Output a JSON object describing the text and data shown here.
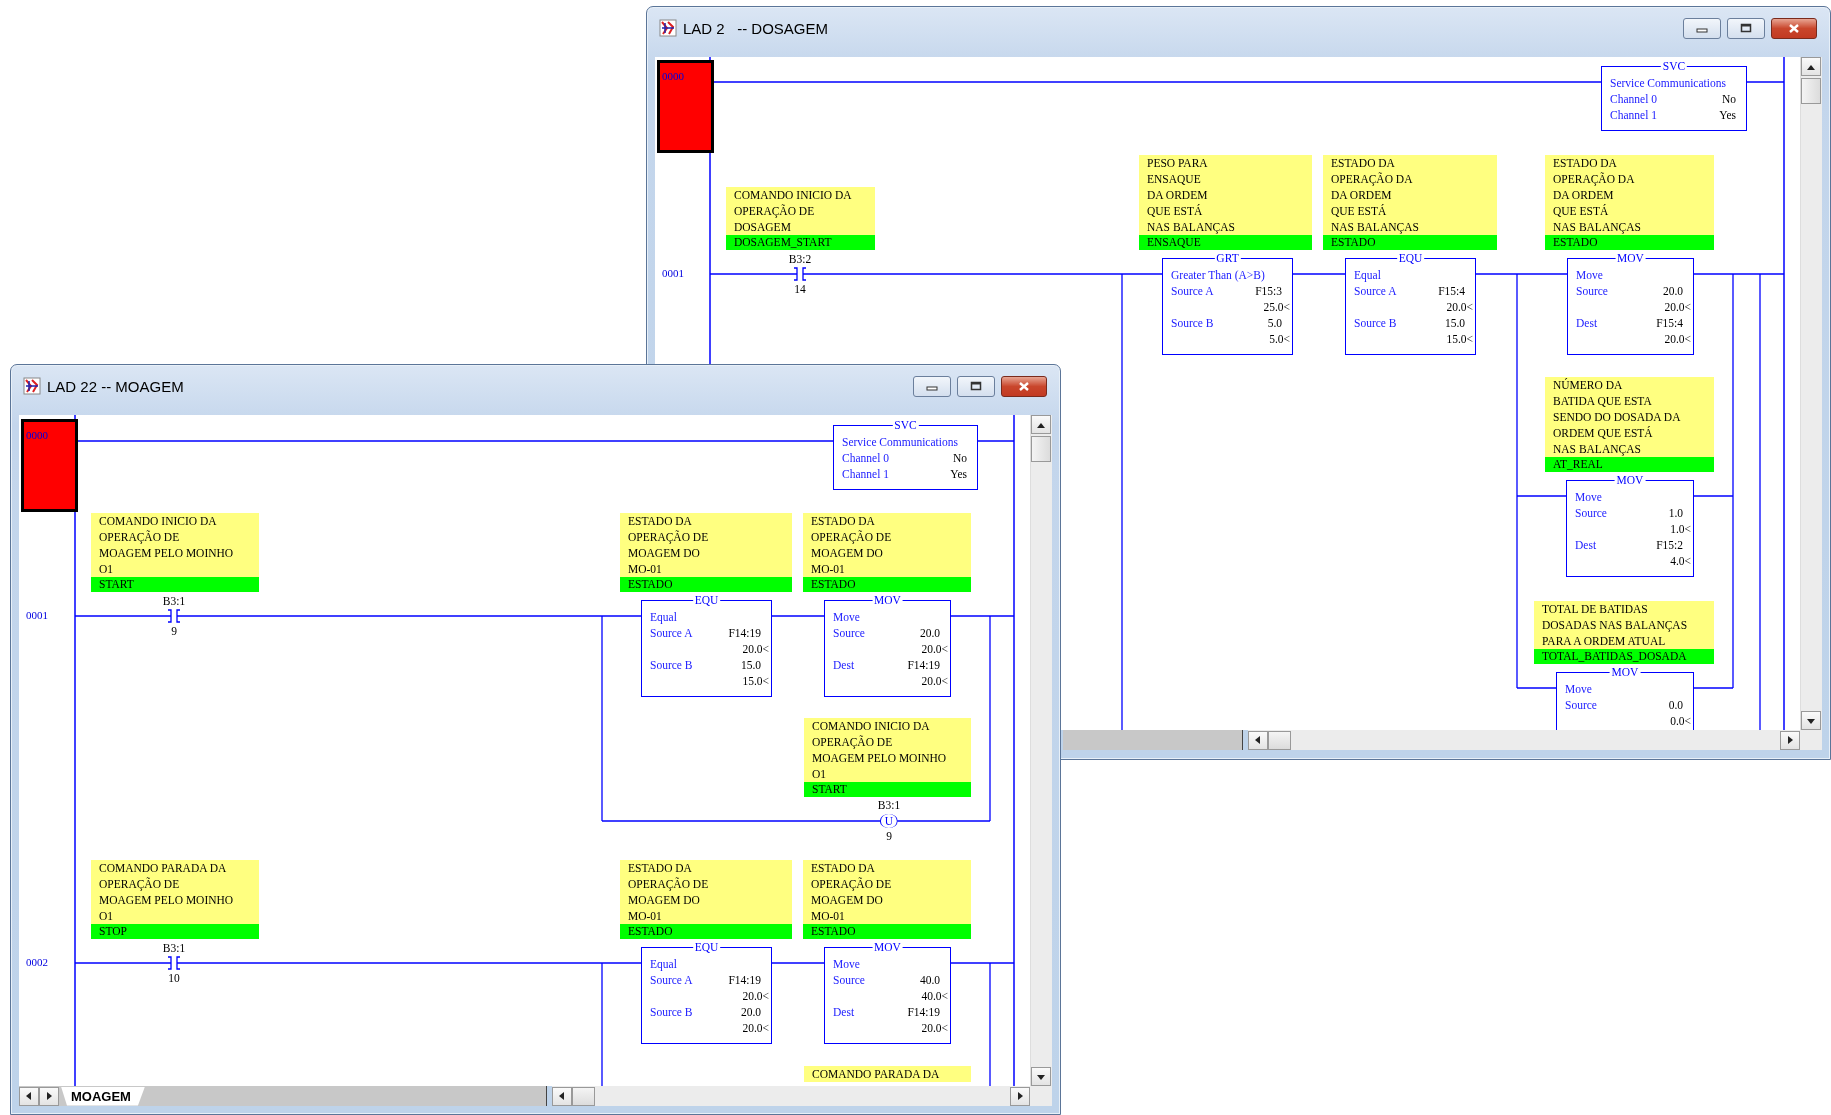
{
  "windows": [
    {
      "title": "LAD 2   -- DOSAGEM",
      "rungs": [
        {
          "number": "0000",
          "selected": true,
          "elements": [
            {
              "kind": "svc",
              "mnemonic": "SVC",
              "description": "Service Communications",
              "rows": [
                {
                  "label": "Channel 0",
                  "value": "No"
                },
                {
                  "label": "Channel 1",
                  "value": "Yes"
                }
              ]
            }
          ]
        },
        {
          "number": "0001",
          "selected": false,
          "elements": [
            {
              "kind": "xic",
              "comment": "COMANDO INICIO DA\nOPERAÇÃO DE\nDOSAGEM",
              "symbol": "DOSAGEM_START",
              "address": "B3:2",
              "bit": "14"
            },
            {
              "kind": "box",
              "mnemonic": "GRT",
              "comment": "PESO PARA\nENSAQUE\nDA ORDEM\nQUE ESTÁ\nNAS BALANÇAS",
              "symbol": "ENSAQUE",
              "description": "Greater Than (A>B)",
              "operands": [
                {
                  "label": "Source A",
                  "address": "F15:3",
                  "value": "25.0<"
                },
                {
                  "label": "Source B",
                  "address": "5.0",
                  "value": "5.0<"
                }
              ]
            },
            {
              "kind": "box",
              "mnemonic": "EQU",
              "comment": "ESTADO DA\nOPERAÇÃO DA\nDA ORDEM\nQUE ESTÁ\nNAS BALANÇAS",
              "symbol": "ESTADO",
              "description": "Equal",
              "operands": [
                {
                  "label": "Source A",
                  "address": "F15:4",
                  "value": "20.0<"
                },
                {
                  "label": "Source B",
                  "address": "15.0",
                  "value": "15.0<"
                }
              ]
            },
            {
              "kind": "box",
              "mnemonic": "MOV",
              "comment": "ESTADO DA\nOPERAÇÃO DA\nDA ORDEM\nQUE ESTÁ\nNAS BALANÇAS",
              "symbol": "ESTADO",
              "description": "Move",
              "operands": [
                {
                  "label": "Source",
                  "address": "20.0",
                  "value": "20.0<"
                },
                {
                  "label": "Dest",
                  "address": "F15:4",
                  "value": "20.0<"
                }
              ]
            },
            {
              "kind": "box",
              "mnemonic": "MOV",
              "comment": "NÚMERO DA\nBATIDA QUE ESTA\nSENDO DO DOSADA DA\nORDEM QUE ESTÁ\nNAS BALANÇAS",
              "symbol": "AT_REAL",
              "description": "Move",
              "operands": [
                {
                  "label": "Source",
                  "address": "1.0",
                  "value": "1.0<"
                },
                {
                  "label": "Dest",
                  "address": "F15:2",
                  "value": "4.0<"
                }
              ]
            },
            {
              "kind": "box",
              "mnemonic": "MOV",
              "comment": "TOTAL DE BATIDAS\nDOSADAS NAS BALANÇAS\nPARA A ORDEM ATUAL",
              "symbol": "TOTAL_BATIDAS_DOSADA",
              "description": "Move",
              "operands": [
                {
                  "label": "Source",
                  "address": "0.0",
                  "value": "0.0<"
                }
              ]
            }
          ]
        }
      ]
    },
    {
      "title": "LAD 22 -- MOAGEM",
      "sheet_tabs": [
        {
          "label": "MOAGEM",
          "selected": true
        }
      ],
      "rungs": [
        {
          "number": "0000",
          "selected": true,
          "elements": [
            {
              "kind": "svc",
              "mnemonic": "SVC",
              "description": "Service Communications",
              "rows": [
                {
                  "label": "Channel 0",
                  "value": "No"
                },
                {
                  "label": "Channel 1",
                  "value": "Yes"
                }
              ]
            }
          ]
        },
        {
          "number": "0001",
          "selected": false,
          "elements": [
            {
              "kind": "xic",
              "comment": "COMANDO INICIO DA\nOPERAÇÃO DE\nMOAGEM PELO MOINHO\nO1",
              "symbol": "START",
              "address": "B3:1",
              "bit": "9"
            },
            {
              "kind": "box",
              "mnemonic": "EQU",
              "comment": "ESTADO DA\nOPERAÇÃO DE\nMOAGEM DO\nMO-01",
              "symbol": "ESTADO",
              "description": "Equal",
              "operands": [
                {
                  "label": "Source A",
                  "address": "F14:19",
                  "value": "20.0<"
                },
                {
                  "label": "Source B",
                  "address": "15.0",
                  "value": "15.0<"
                }
              ]
            },
            {
              "kind": "box",
              "mnemonic": "MOV",
              "comment": "ESTADO DA\nOPERAÇÃO DE\nMOAGEM DO\nMO-01",
              "symbol": "ESTADO",
              "description": "Move",
              "operands": [
                {
                  "label": "Source",
                  "address": "20.0",
                  "value": "20.0<"
                },
                {
                  "label": "Dest",
                  "address": "F14:19",
                  "value": "20.0<"
                }
              ]
            },
            {
              "kind": "otu",
              "comment": "COMANDO INICIO DA\nOPERAÇÃO DE\nMOAGEM PELO MOINHO\nO1",
              "symbol": "START",
              "address": "B3:1",
              "letter": "U",
              "bit": "9"
            }
          ]
        },
        {
          "number": "0002",
          "selected": false,
          "elements": [
            {
              "kind": "xic",
              "comment": "COMANDO PARADA DA\nOPERAÇÃO DE\nMOAGEM PELO MOINHO\nO1",
              "symbol": "STOP",
              "address": "B3:1",
              "bit": "10"
            },
            {
              "kind": "box",
              "mnemonic": "EQU",
              "comment": "ESTADO DA\nOPERAÇÃO DE\nMOAGEM DO\nMO-01",
              "symbol": "ESTADO",
              "description": "Equal",
              "operands": [
                {
                  "label": "Source A",
                  "address": "F14:19",
                  "value": "20.0<"
                },
                {
                  "label": "Source B",
                  "address": "20.0",
                  "value": "20.0<"
                }
              ]
            },
            {
              "kind": "box",
              "mnemonic": "MOV",
              "comment": "ESTADO DA\nOPERAÇÃO DE\nMOAGEM DO\nMO-01",
              "symbol": "ESTADO",
              "description": "Move",
              "operands": [
                {
                  "label": "Source",
                  "address": "40.0",
                  "value": "40.0<"
                },
                {
                  "label": "Dest",
                  "address": "F14:19",
                  "value": "20.0<"
                }
              ]
            },
            {
              "kind": "comment",
              "comment": "COMANDO PARADA DA"
            }
          ]
        }
      ]
    }
  ]
}
